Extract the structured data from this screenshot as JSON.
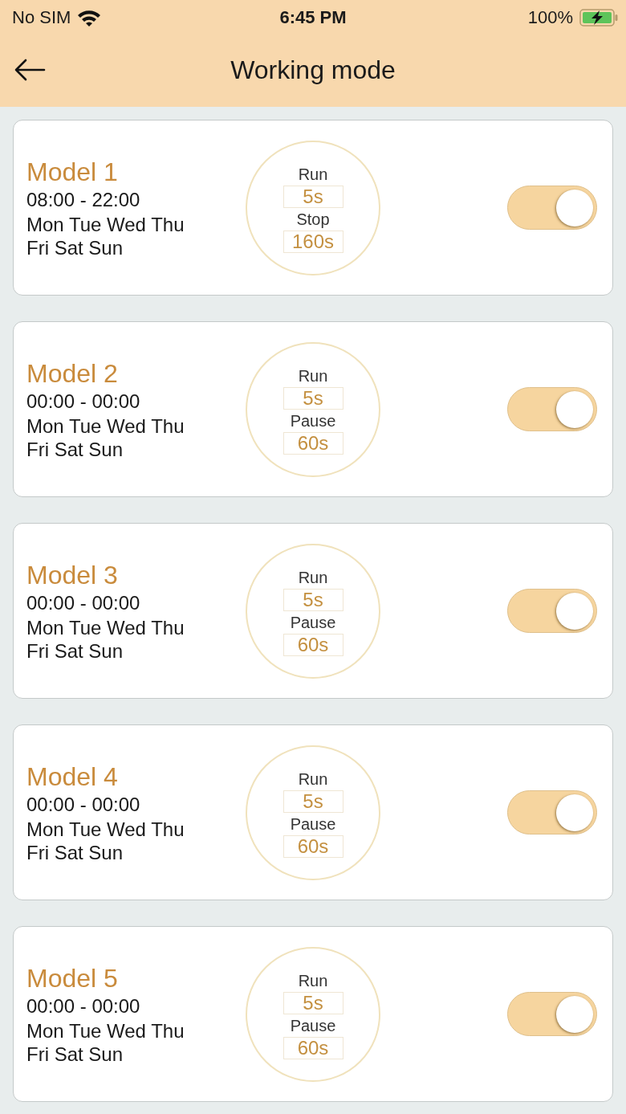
{
  "status_bar": {
    "carrier": "No SIM",
    "time": "6:45 PM",
    "battery": "100%"
  },
  "header": {
    "title": "Working mode"
  },
  "modes": [
    {
      "name": "Model 1",
      "hours": "08:00 - 22:00",
      "days": "Mon Tue Wed Thu Fri Sat Sun",
      "run_label": "Run",
      "run_value": "5s",
      "rest_label": "Stop",
      "rest_value": "160s",
      "on": true
    },
    {
      "name": "Model 2",
      "hours": "00:00 - 00:00",
      "days": "Mon Tue Wed Thu Fri Sat Sun",
      "run_label": "Run",
      "run_value": "5s",
      "rest_label": "Pause",
      "rest_value": "60s",
      "on": true
    },
    {
      "name": "Model 3",
      "hours": "00:00 - 00:00",
      "days": "Mon Tue Wed Thu Fri Sat Sun",
      "run_label": "Run",
      "run_value": "5s",
      "rest_label": "Pause",
      "rest_value": "60s",
      "on": true
    },
    {
      "name": "Model 4",
      "hours": "00:00 - 00:00",
      "days": "Mon Tue Wed Thu Fri Sat Sun",
      "run_label": "Run",
      "run_value": "5s",
      "rest_label": "Pause",
      "rest_value": "60s",
      "on": true
    },
    {
      "name": "Model 5",
      "hours": "00:00 - 00:00",
      "days": "Mon Tue Wed Thu Fri Sat Sun",
      "run_label": "Run",
      "run_value": "5s",
      "rest_label": "Pause",
      "rest_value": "60s",
      "on": true
    }
  ]
}
